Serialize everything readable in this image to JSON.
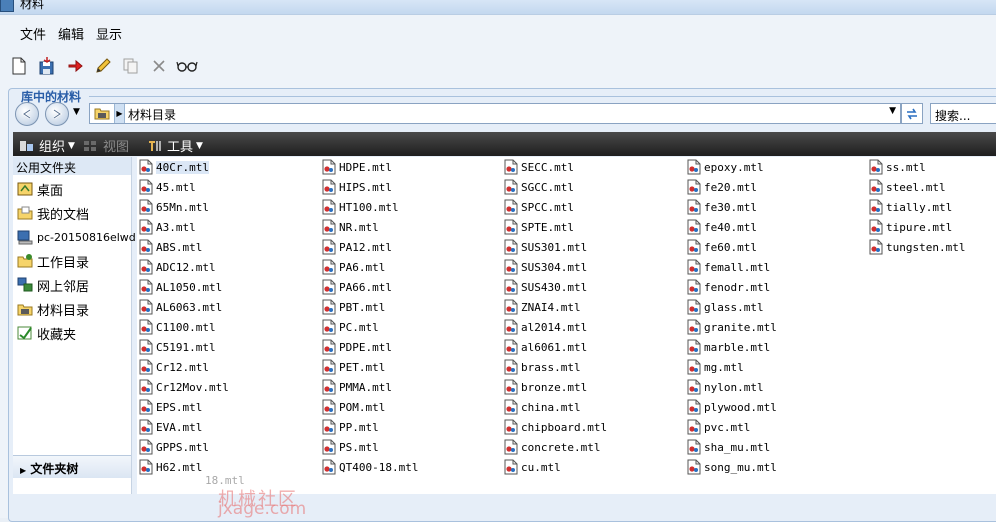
{
  "window": {
    "title": "材料"
  },
  "menu": [
    {
      "label": "文件",
      "name": "menu-file"
    },
    {
      "label": "编辑",
      "name": "menu-edit"
    },
    {
      "label": "显示",
      "name": "menu-view"
    }
  ],
  "library": {
    "title": "库中的材料",
    "address": "材料目录",
    "search_placeholder": "搜索..."
  },
  "command_bar": {
    "organize": "组织",
    "view": "视图",
    "tools": "工具"
  },
  "sidebar": {
    "header": "公用文件夹",
    "items": [
      {
        "label": "桌面",
        "icon": "desktop-icon"
      },
      {
        "label": "我的文档",
        "icon": "documents-icon"
      },
      {
        "label": "pc-20150816elwd",
        "icon": "computer-icon"
      },
      {
        "label": "工作目录",
        "icon": "work-folder-icon"
      },
      {
        "label": "网上邻居",
        "icon": "network-icon"
      },
      {
        "label": "材料目录",
        "icon": "materials-folder-icon"
      },
      {
        "label": "收藏夹",
        "icon": "favorites-icon"
      }
    ],
    "folder_tree": "文件夹树"
  },
  "files": [
    [
      "40Cr.mtl",
      "45.mtl",
      "65Mn.mtl",
      "A3.mtl",
      "ABS.mtl",
      "ADC12.mtl",
      "AL1050.mtl",
      "AL6063.mtl",
      "C1100.mtl",
      "C5191.mtl",
      "Cr12.mtl",
      "Cr12Mov.mtl",
      "EPS.mtl",
      "EVA.mtl",
      "GPPS.mtl",
      "H62.mtl"
    ],
    [
      "HDPE.mtl",
      "HIPS.mtl",
      "HT100.mtl",
      "NR.mtl",
      "PA12.mtl",
      "PA6.mtl",
      "PA66.mtl",
      "PBT.mtl",
      "PC.mtl",
      "PDPE.mtl",
      "PET.mtl",
      "PMMA.mtl",
      "POM.mtl",
      "PP.mtl",
      "PS.mtl",
      "QT400-18.mtl"
    ],
    [
      "SECC.mtl",
      "SGCC.mtl",
      "SPCC.mtl",
      "SPTE.mtl",
      "SUS301.mtl",
      "SUS304.mtl",
      "SUS430.mtl",
      "ZNAI4.mtl",
      "al2014.mtl",
      "al6061.mtl",
      "brass.mtl",
      "bronze.mtl",
      "china.mtl",
      "chipboard.mtl",
      "concrete.mtl",
      "cu.mtl"
    ],
    [
      "epoxy.mtl",
      "fe20.mtl",
      "fe30.mtl",
      "fe40.mtl",
      "fe60.mtl",
      "femall.mtl",
      "fenodr.mtl",
      "glass.mtl",
      "granite.mtl",
      "marble.mtl",
      "mg.mtl",
      "nylon.mtl",
      "plywood.mtl",
      "pvc.mtl",
      "sha_mu.mtl",
      "song_mu.mtl"
    ],
    [
      "ss.mtl",
      "steel.mtl",
      "tially.mtl",
      "tipure.mtl",
      "tungsten.mtl"
    ]
  ],
  "selected_file": "40Cr.mtl",
  "overlap_text": "18.mtl",
  "watermark": {
    "line1": "机械社区",
    "line2": "jxage.com"
  },
  "colors": {
    "accent": "#2a5ea8",
    "selection": "#dbe7f6",
    "command_bar": "#2a2a2a"
  }
}
